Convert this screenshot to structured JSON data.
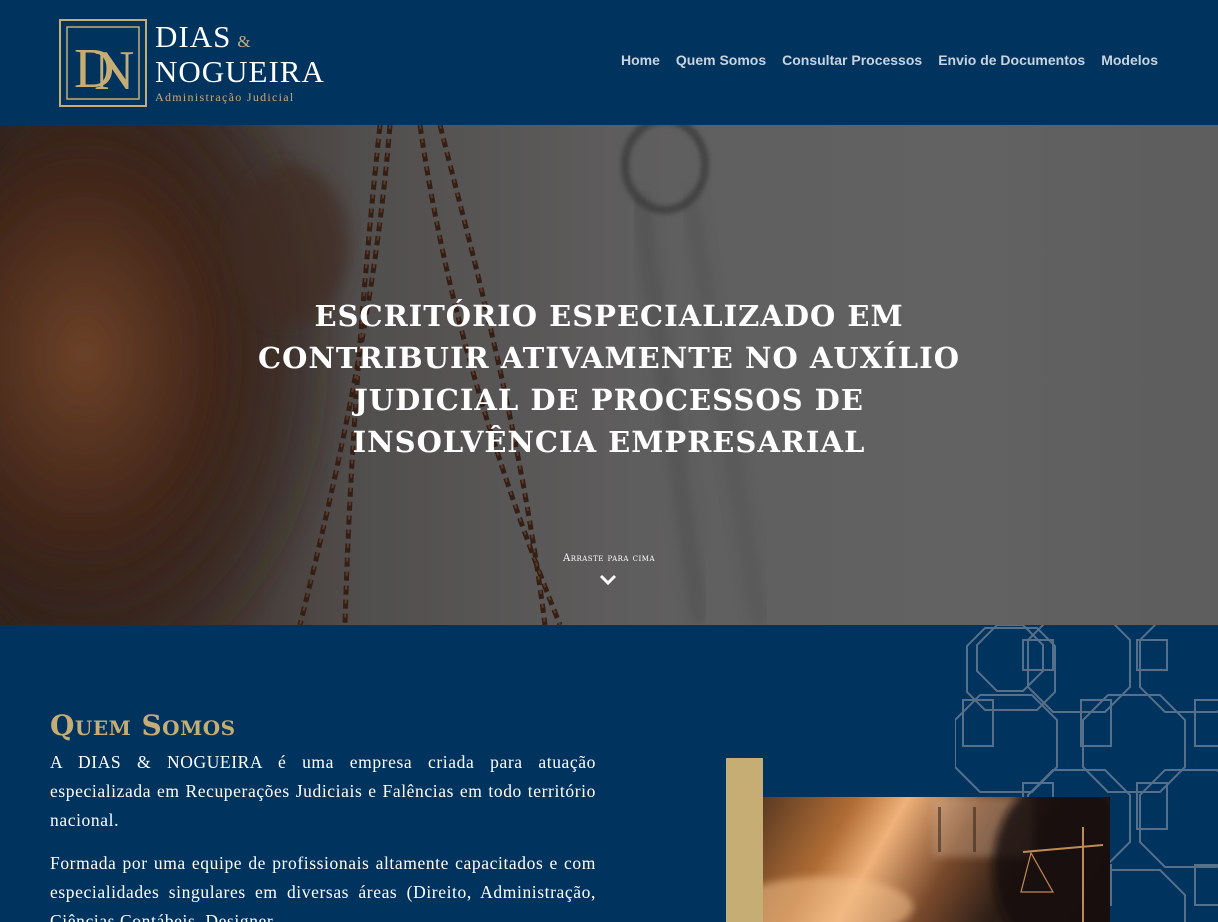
{
  "brand": {
    "monogram": "DN",
    "line1": "DIAS",
    "ampersand": "&",
    "line2": "NOGUEIRA",
    "tagline": "Administração Judicial",
    "gold_color": "#c6ad74",
    "navy_color": "#01335f"
  },
  "nav": {
    "items": [
      {
        "label": "Home"
      },
      {
        "label": "Quem Somos"
      },
      {
        "label": "Consultar Processos"
      },
      {
        "label": "Envio de Documentos"
      },
      {
        "label": "Modelos"
      }
    ]
  },
  "hero": {
    "title": "Escritório especializado em contribuir ativamente no auxílio judicial de processos de insolvência empresarial",
    "scroll_label": "Arraste para cima",
    "scroll_icon": "chevron-down-icon"
  },
  "about": {
    "title": "Quem Somos",
    "paragraphs": [
      "A DIAS & NOGUEIRA é uma empresa criada para atuação especializada em Recuperações Judiciais e Falências em todo território nacional.",
      "Formada por uma equipe de profissionais altamente capacitados e com especialidades singulares em diversas áreas (Direito, Administração, Ciências Contábeis, Designer"
    ]
  }
}
